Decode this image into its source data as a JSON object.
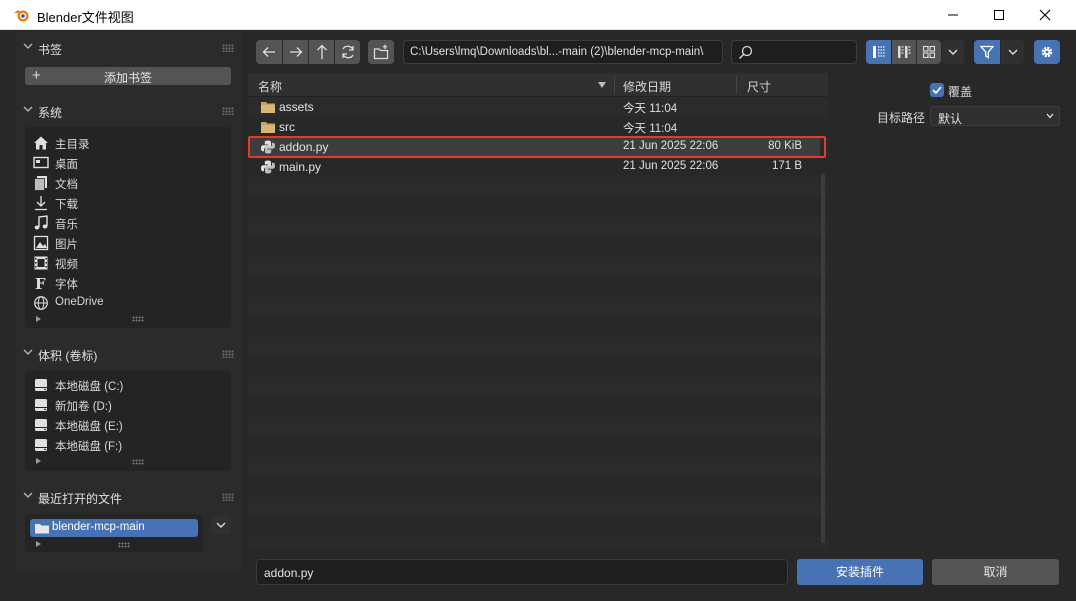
{
  "window": {
    "title": "Blender文件视图"
  },
  "sidebar": {
    "bookmarks": {
      "title": "书签",
      "add_label": "添加书签"
    },
    "system": {
      "title": "系统",
      "items": [
        {
          "label": "主目录",
          "icon": "home-icon"
        },
        {
          "label": "桌面",
          "icon": "desktop-icon"
        },
        {
          "label": "文档",
          "icon": "documents-icon"
        },
        {
          "label": "下载",
          "icon": "download-icon"
        },
        {
          "label": "音乐",
          "icon": "music-icon"
        },
        {
          "label": "图片",
          "icon": "image-icon"
        },
        {
          "label": "视频",
          "icon": "video-icon"
        },
        {
          "label": "字体",
          "icon": "font-icon"
        },
        {
          "label": "OneDrive",
          "icon": "globe-icon"
        }
      ]
    },
    "volumes": {
      "title": "体积 (卷标)",
      "items": [
        {
          "label": "本地磁盘 (C:)",
          "icon": "disk-icon"
        },
        {
          "label": "新加卷 (D:)",
          "icon": "disk-icon"
        },
        {
          "label": "本地磁盘 (E:)",
          "icon": "disk-icon"
        },
        {
          "label": "本地磁盘 (F:)",
          "icon": "disk-icon"
        }
      ]
    },
    "recent": {
      "title": "最近打开的文件",
      "items": [
        {
          "label": "blender-mcp-main",
          "icon": "folder-icon"
        }
      ]
    }
  },
  "toolbar": {
    "path": "C:\\Users\\lmq\\Downloads\\bl...-main (2)\\blender-mcp-main\\",
    "search_placeholder": ""
  },
  "filelist": {
    "columns": {
      "name": "名称",
      "date": "修改日期",
      "size": "尺寸"
    },
    "rows": [
      {
        "name": "assets",
        "date": "今天 11:04",
        "size": "",
        "type": "folder"
      },
      {
        "name": "src",
        "date": "今天 11:04",
        "size": "",
        "type": "folder"
      },
      {
        "name": "addon.py",
        "date": "21 Jun 2025 22:06",
        "size": "80 KiB",
        "type": "python",
        "selected": true
      },
      {
        "name": "main.py",
        "date": "21 Jun 2025 22:06",
        "size": "171 B",
        "type": "python"
      }
    ]
  },
  "options": {
    "overwrite_label": "覆盖",
    "overwrite_checked": true,
    "target_path_label": "目标路径",
    "target_path_value": "默认"
  },
  "footer": {
    "filename": "addon.py",
    "confirm_label": "安装插件",
    "cancel_label": "取消"
  },
  "colors": {
    "accent": "#4772b3",
    "highlight": "#e23a2b",
    "background": "#282828"
  }
}
